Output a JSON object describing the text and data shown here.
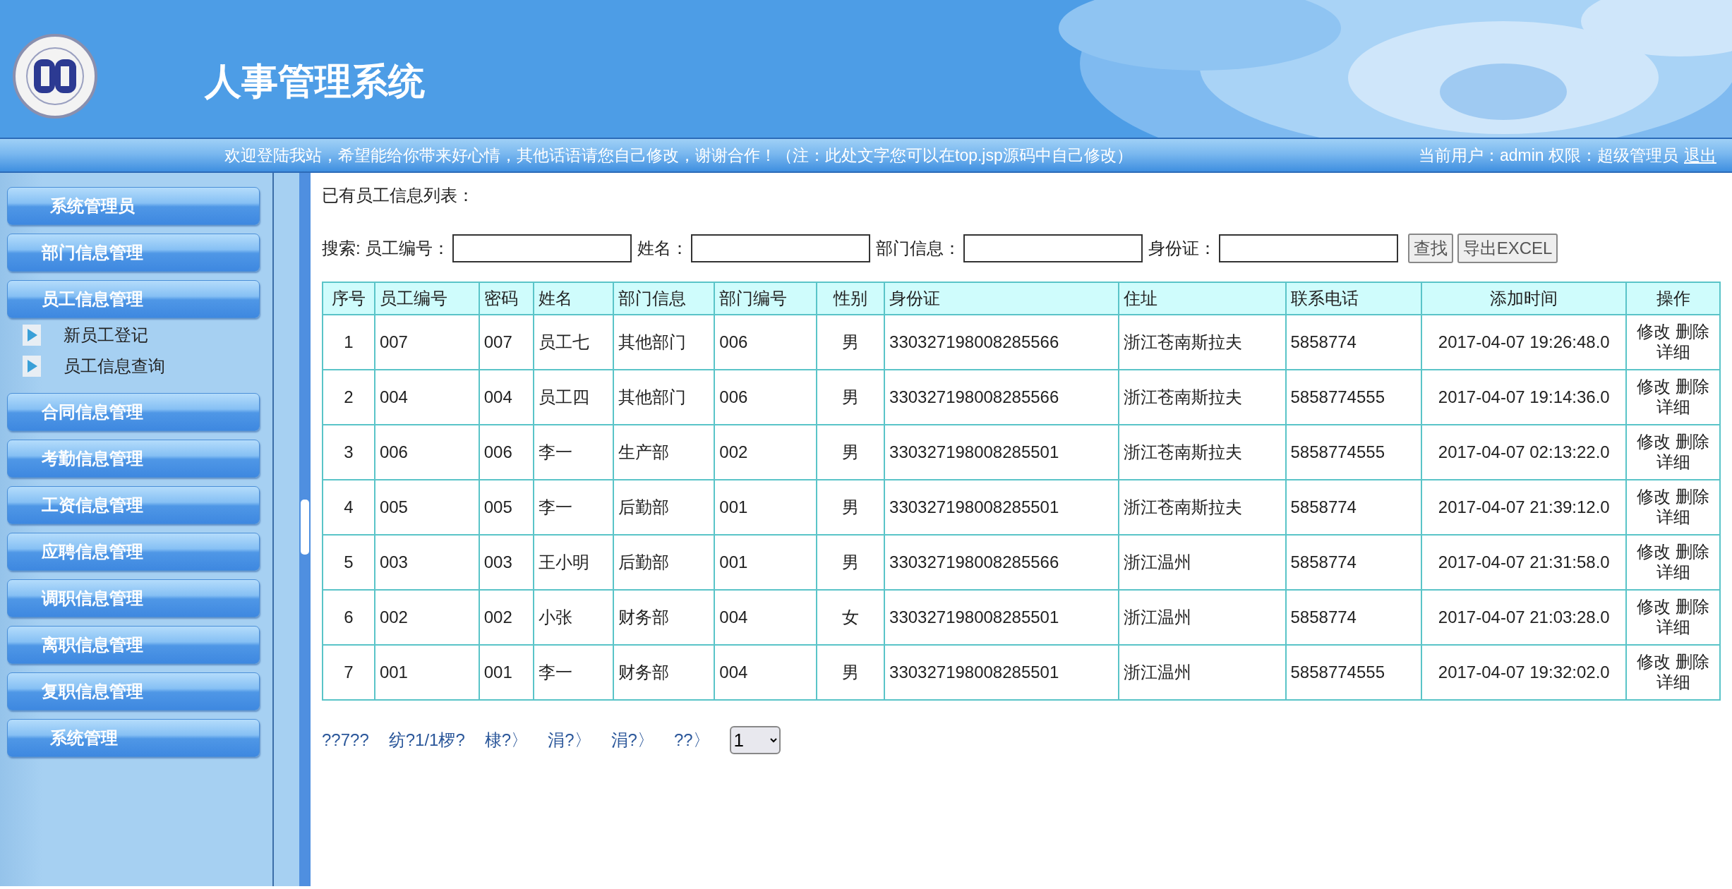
{
  "header": {
    "title": "人事管理系统"
  },
  "welcome_bar": {
    "message": "欢迎登陆我站，希望能给你带来好心情，其他话语请您自己修改，谢谢合作！（注：此处文字您可以在top.jsp源码中自己修改）",
    "user_info": "当前用户：admin 权限：超级管理员",
    "logout": "退出"
  },
  "sidebar": {
    "items": [
      {
        "label": "系统管理员"
      },
      {
        "label": "部门信息管理"
      },
      {
        "label": "员工信息管理",
        "children": [
          {
            "label": "新员工登记"
          },
          {
            "label": "员工信息查询"
          }
        ]
      },
      {
        "label": "合同信息管理"
      },
      {
        "label": "考勤信息管理"
      },
      {
        "label": "工资信息管理"
      },
      {
        "label": "应聘信息管理"
      },
      {
        "label": "调职信息管理"
      },
      {
        "label": "离职信息管理"
      },
      {
        "label": "复职信息管理"
      },
      {
        "label": "系统管理"
      }
    ]
  },
  "content": {
    "title": "已有员工信息列表：",
    "search": {
      "label": "搜索:",
      "fields": [
        {
          "label": "员工编号："
        },
        {
          "label": "姓名："
        },
        {
          "label": "部门信息："
        },
        {
          "label": "身份证："
        }
      ],
      "buttons": [
        "查找",
        "导出EXCEL"
      ]
    },
    "table": {
      "columns": [
        "序号",
        "员工编号",
        "密码",
        "姓名",
        "部门信息",
        "部门编号",
        "性别",
        "身份证",
        "住址",
        "联系电话",
        "添加时间",
        "操作"
      ],
      "rows": [
        {
          "cells": [
            "1",
            "007",
            "007",
            "员工七",
            "其他部门",
            "006",
            "男",
            "330327198008285566",
            "浙江苍南斯拉夫",
            "5858774",
            "2017-04-07 19:26:48.0"
          ],
          "actions": [
            "修改",
            "删除",
            "详细"
          ]
        },
        {
          "cells": [
            "2",
            "004",
            "004",
            "员工四",
            "其他部门",
            "006",
            "男",
            "330327198008285566",
            "浙江苍南斯拉夫",
            "5858774555",
            "2017-04-07 19:14:36.0"
          ],
          "actions": [
            "修改",
            "删除",
            "详细"
          ]
        },
        {
          "cells": [
            "3",
            "006",
            "006",
            "李一",
            "生产部",
            "002",
            "男",
            "330327198008285501",
            "浙江苍南斯拉夫",
            "5858774555",
            "2017-04-07 02:13:22.0"
          ],
          "actions": [
            "修改",
            "删除",
            "详细"
          ]
        },
        {
          "cells": [
            "4",
            "005",
            "005",
            "李一",
            "后勤部",
            "001",
            "男",
            "330327198008285501",
            "浙江苍南斯拉夫",
            "5858774",
            "2017-04-07 21:39:12.0"
          ],
          "actions": [
            "修改",
            "删除",
            "详细"
          ]
        },
        {
          "cells": [
            "5",
            "003",
            "003",
            "王小明",
            "后勤部",
            "001",
            "男",
            "330327198008285566",
            "浙江温州",
            "5858774",
            "2017-04-07 21:31:58.0"
          ],
          "actions": [
            "修改",
            "删除",
            "详细"
          ]
        },
        {
          "cells": [
            "6",
            "002",
            "002",
            "小张",
            "财务部",
            "004",
            "女",
            "330327198008285501",
            "浙江温州",
            "5858774",
            "2017-04-07 21:03:28.0"
          ],
          "actions": [
            "修改",
            "删除",
            "详细"
          ]
        },
        {
          "cells": [
            "7",
            "001",
            "001",
            "李一",
            "财务部",
            "004",
            "男",
            "330327198008285501",
            "浙江温州",
            "5858774555",
            "2017-04-07 19:32:02.0"
          ],
          "actions": [
            "修改",
            "删除",
            "详细"
          ]
        }
      ]
    },
    "pagination": {
      "links": [
        "??7??",
        "纺?1/1椤?",
        "棣?〉",
        "涓?〉",
        "涓?〉",
        "??〉"
      ],
      "page_select": "1"
    }
  }
}
